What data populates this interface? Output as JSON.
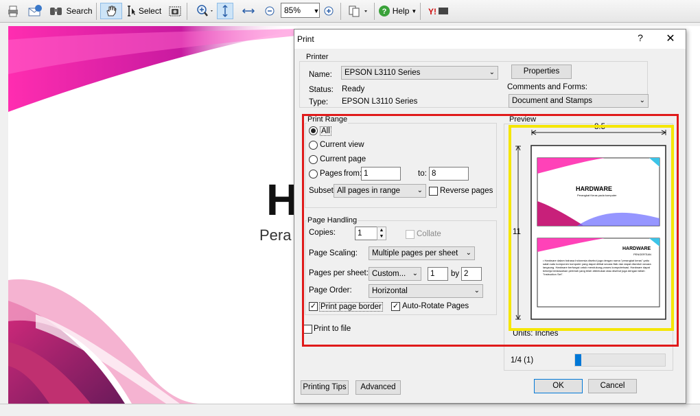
{
  "toolbar": {
    "search_label": "Search",
    "select_label": "Select",
    "zoom_value": "85%",
    "help_label": "Help"
  },
  "slide": {
    "title_partial": "H",
    "subtitle_partial": "Pera"
  },
  "dialog": {
    "title": "Print",
    "help_glyph": "?",
    "close_glyph": "✕",
    "printer": {
      "group_label": "Printer",
      "name_label": "Name:",
      "name_value": "EPSON L3110 Series",
      "status_label": "Status:",
      "status_value": "Ready",
      "type_label": "Type:",
      "type_value": "EPSON L3110 Series",
      "properties_button": "Properties",
      "comments_label": "Comments and Forms:",
      "comments_value": "Document and Stamps"
    },
    "print_range": {
      "group_label": "Print Range",
      "all": "All",
      "current_view": "Current view",
      "current_page": "Current page",
      "pages": "Pages",
      "from_label": "from:",
      "from_value": "1",
      "to_label": "to:",
      "to_value": "8",
      "subset_label": "Subset:",
      "subset_value": "All pages in range",
      "reverse_label": "Reverse pages"
    },
    "page_handling": {
      "group_label": "Page Handling",
      "copies_label": "Copies:",
      "copies_value": "1",
      "collate_label": "Collate",
      "scaling_label": "Page Scaling:",
      "scaling_value": "Multiple pages per sheet",
      "pps_label": "Pages per sheet:",
      "pps_value": "Custom...",
      "pps_cols": "1",
      "by_label": "by",
      "pps_rows": "2",
      "order_label": "Page Order:",
      "order_value": "Horizontal",
      "border_label": "Print page border",
      "autorotate_label": "Auto-Rotate Pages"
    },
    "print_to_file": "Print to file",
    "preview": {
      "group_label": "Preview",
      "width": "8.5",
      "height": "11",
      "units": "Units: Inches",
      "page_counter": "1/4 (1)",
      "slide1_title": "HARDWARE",
      "slide1_sub": "Perangkat Keras pada komputer",
      "slide2_title": "HARDWARE",
      "slide2_sub": "PENGERTIAN",
      "slide2_body": "• Hardware dalam bahasa Indonesia disebut juga dengan nama \"perangkat keras\" yaitu salah satu komponen komputer yang dapat dilihat secara fisik dan dapat disentuh secara langsung. Hardware berfungsi untuk mendukung proses komputerisasi. Hardware dapat bekerja berdasarkan perintah yang telah ditentukan atau disebut juga dengan istilah \"Instruction Set\"."
    },
    "buttons": {
      "printing_tips": "Printing Tips",
      "advanced": "Advanced",
      "ok": "OK",
      "cancel": "Cancel"
    }
  }
}
